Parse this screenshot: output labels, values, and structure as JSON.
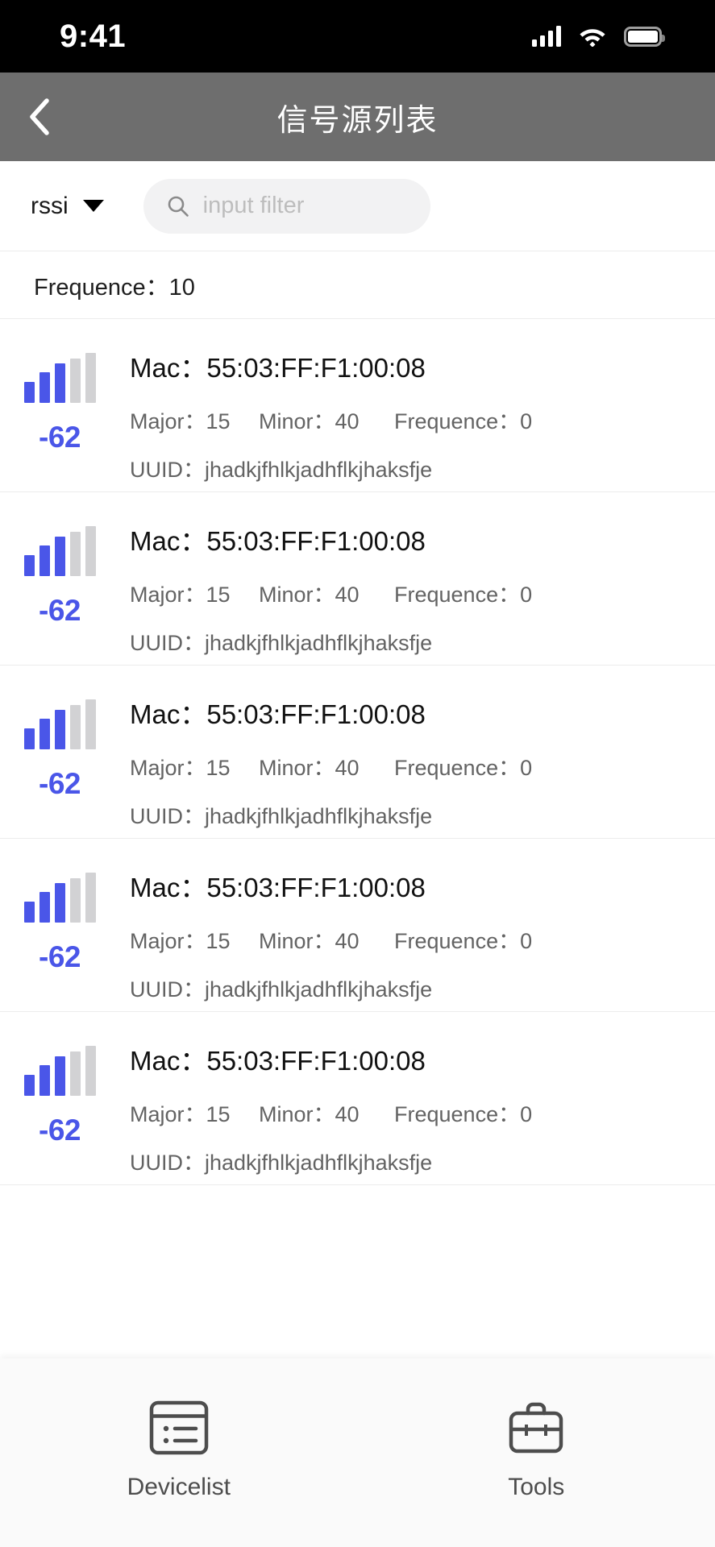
{
  "status_bar": {
    "time": "9:41",
    "cellular_icon": "cellular-bars-icon",
    "wifi_icon": "wifi-icon",
    "battery_icon": "battery-full-icon"
  },
  "header": {
    "title": "信号源列表",
    "back_icon": "chevron-left-icon",
    "background_color": "#6e6e6e"
  },
  "filter_bar": {
    "sort_value": "rssi",
    "sort_caret_icon": "caret-down-icon",
    "search_icon": "search-icon",
    "search_value": "",
    "search_placeholder": "input filter"
  },
  "summary": {
    "text": "Frequence：10"
  },
  "labels": {
    "mac": "Mac：",
    "major": "Major：",
    "minor": "Minor：",
    "frequence": "Frequence：",
    "uuid": "UUID："
  },
  "colors": {
    "accent": "#4a56e8",
    "bar_inactive": "#d2d2d4",
    "header": "#6e6e6e",
    "divider": "#ececec"
  },
  "devices": [
    {
      "signal_icon": "signal-bars-icon",
      "bars_total": 5,
      "bars_active": 3,
      "rssi": "-62",
      "mac": "55:03:FF:F1:00:08",
      "major": "15",
      "minor": "40",
      "frequence": "0",
      "uuid": "jhadkjfhlkjadhflkjhaksfje"
    },
    {
      "signal_icon": "signal-bars-icon",
      "bars_total": 5,
      "bars_active": 3,
      "rssi": "-62",
      "mac": "55:03:FF:F1:00:08",
      "major": "15",
      "minor": "40",
      "frequence": "0",
      "uuid": "jhadkjfhlkjadhflkjhaksfje"
    },
    {
      "signal_icon": "signal-bars-icon",
      "bars_total": 5,
      "bars_active": 3,
      "rssi": "-62",
      "mac": "55:03:FF:F1:00:08",
      "major": "15",
      "minor": "40",
      "frequence": "0",
      "uuid": "jhadkjfhlkjadhflkjhaksfje"
    },
    {
      "signal_icon": "signal-bars-icon",
      "bars_total": 5,
      "bars_active": 3,
      "rssi": "-62",
      "mac": "55:03:FF:F1:00:08",
      "major": "15",
      "minor": "40",
      "frequence": "0",
      "uuid": "jhadkjfhlkjadhflkjhaksfje"
    },
    {
      "signal_icon": "signal-bars-icon",
      "bars_total": 5,
      "bars_active": 3,
      "rssi": "-62",
      "mac": "55:03:FF:F1:00:08",
      "major": "15",
      "minor": "40",
      "frequence": "0",
      "uuid": "jhadkjfhlkjadhflkjhaksfje"
    }
  ],
  "tab_bar": {
    "items": [
      {
        "label": "Devicelist",
        "icon": "device-list-icon"
      },
      {
        "label": "Tools",
        "icon": "toolbox-icon"
      }
    ]
  }
}
